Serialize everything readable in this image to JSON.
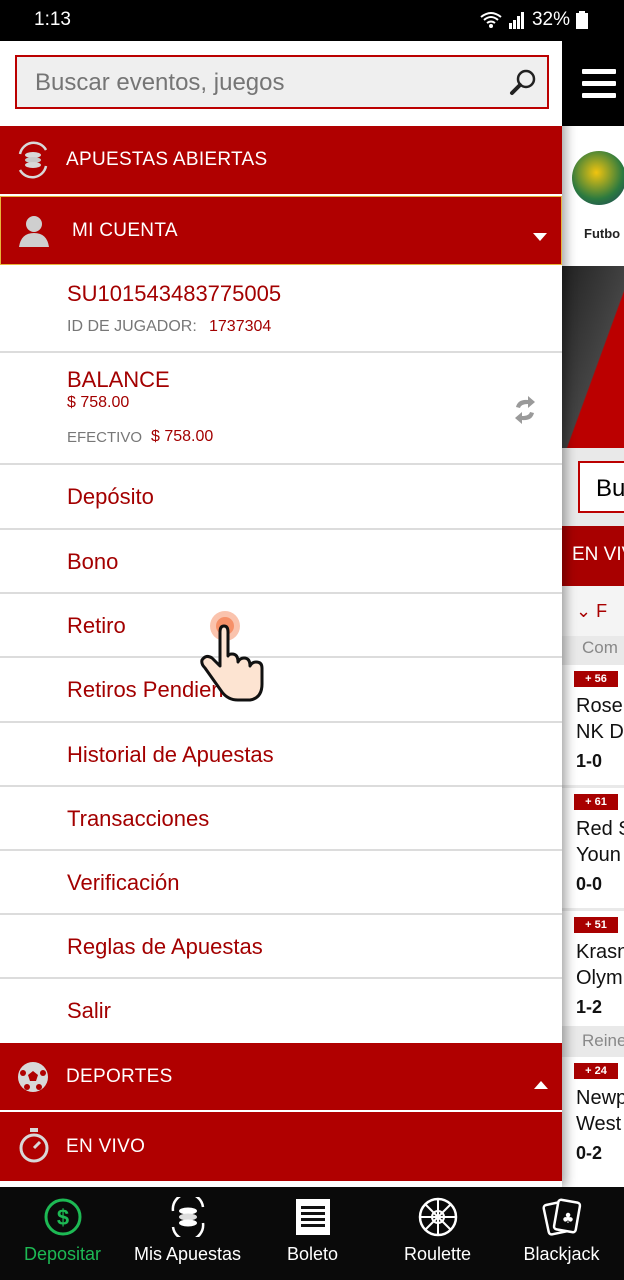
{
  "status": {
    "time": "1:13",
    "battery": "32%"
  },
  "search": {
    "placeholder": "Buscar eventos, juegos",
    "value": "Buscar eventos, juegos"
  },
  "menu": {
    "open_bets": "APUESTAS ABIERTAS",
    "account": "MI CUENTA",
    "sports": "DEPORTES",
    "live": "EN VIVO"
  },
  "account": {
    "username": "SU101543483775005",
    "player_id_label": "ID DE JUGADOR:",
    "player_id": "1737304",
    "balance_label": "BALANCE",
    "balance": "$ 758.00",
    "cash_label": "EFECTIVO",
    "cash": "$ 758.00",
    "items": [
      "Depósito",
      "Bono",
      "Retiro",
      "Retiros Pendientes",
      "Historial de Apuestas",
      "Transacciones",
      "Verificación",
      "Reglas de Apuestas",
      "Salir"
    ]
  },
  "background": {
    "sport_label": "Futbo",
    "search_fragment": "Bu",
    "live_fragment": "EN VIV",
    "filter_fragment": "F",
    "competition_fragment": "Com",
    "matches": [
      {
        "tag": "+ 56",
        "team1": "Rose",
        "team2": "NK D",
        "score": "1-0"
      },
      {
        "tag": "+ 61",
        "team1": "Red S",
        "team2": "Youn",
        "score": "0-0"
      },
      {
        "tag": "+ 51",
        "team1": "Krasn",
        "team2": "Olym",
        "score": "1-2"
      },
      {
        "tag": "+ 24",
        "team1": "Newp",
        "team2": "West",
        "score": "0-2"
      }
    ],
    "region_fragment": "Reine"
  },
  "bottom_nav": [
    {
      "label": "Depositar",
      "icon": "dollar-icon",
      "active": true
    },
    {
      "label": "Mis Apuestas",
      "icon": "coins-refresh-icon",
      "active": false
    },
    {
      "label": "Boleto",
      "icon": "ticket-icon",
      "active": false
    },
    {
      "label": "Roulette",
      "icon": "roulette-icon",
      "active": false
    },
    {
      "label": "Blackjack",
      "icon": "cards-icon",
      "active": false
    }
  ],
  "colors": {
    "brand_red": "#b00000",
    "active_green": "#1db954"
  }
}
